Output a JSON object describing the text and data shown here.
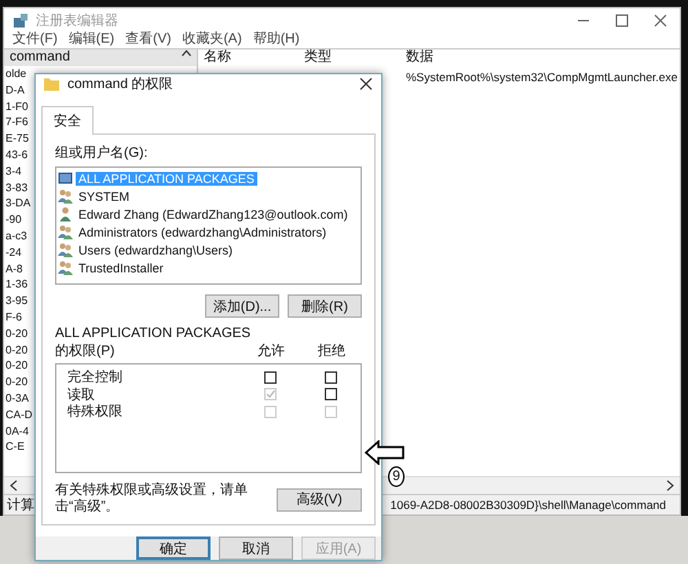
{
  "registry_editor": {
    "title": "注册表编辑器",
    "menu": [
      "文件(F)",
      "编辑(E)",
      "查看(V)",
      "收藏夹(A)",
      "帮助(H)"
    ],
    "tree": {
      "header": "command",
      "items": [
        "olde",
        "D-A",
        "1-F0",
        "7-F6",
        "E-75",
        "43-6",
        "3-4",
        "3-83",
        "3-DA",
        "-90",
        "a-c3",
        "-24",
        "A-8",
        "1-36",
        "3-95",
        "F-6",
        "0-20",
        "0-20",
        "0-20",
        "0-20",
        "0-3A",
        "CA-D",
        "0A-4",
        "C-E"
      ]
    },
    "values": {
      "columns": [
        "名称",
        "类型",
        "数据"
      ],
      "data": "%SystemRoot%\\system32\\CompMgmtLauncher.exe"
    },
    "status_bar": [
      "计算",
      "1069-A2D8-08002B30309D}\\shell\\Manage\\command"
    ]
  },
  "dialog": {
    "title": "command 的权限",
    "tabs": [
      {
        "label": "安全",
        "selected": true
      }
    ],
    "group_label": "组或用户名(G):",
    "principals": [
      {
        "name": "ALL APPLICATION PACKAGES",
        "kind": "package",
        "selected": true
      },
      {
        "name": "SYSTEM",
        "kind": "group",
        "selected": false
      },
      {
        "name": "Edward Zhang (EdwardZhang123@outlook.com)",
        "kind": "user",
        "selected": false
      },
      {
        "name": "Administrators (edwardzhang\\Administrators)",
        "kind": "group",
        "selected": false
      },
      {
        "name": "Users (edwardzhang\\Users)",
        "kind": "group",
        "selected": false
      },
      {
        "name": "TrustedInstaller",
        "kind": "group",
        "selected": false
      }
    ],
    "buttons": [
      "添加(D)...",
      "删除(R)"
    ],
    "permissions_for": "ALL APPLICATION PACKAGES",
    "permissions_label": "的权限(P)",
    "columns": [
      "允许",
      "拒绝"
    ],
    "permissions": [
      {
        "name": "完全控制",
        "allow": {
          "checked": false,
          "disabled": false
        },
        "deny": {
          "checked": false,
          "disabled": false
        }
      },
      {
        "name": "读取",
        "allow": {
          "checked": true,
          "disabled": true
        },
        "deny": {
          "checked": false,
          "disabled": false
        }
      },
      {
        "name": "特殊权限",
        "allow": {
          "checked": false,
          "disabled": true
        },
        "deny": {
          "checked": false,
          "disabled": true
        }
      }
    ],
    "advanced_note": "有关特殊权限或高级设置，请单击“高级”。",
    "advanced_button": "高级(V)",
    "footer_buttons": [
      {
        "label": "确定",
        "default": true,
        "disabled": false
      },
      {
        "label": "取消",
        "default": false,
        "disabled": false
      },
      {
        "label": "应用(A)",
        "default": false,
        "disabled": true
      }
    ]
  },
  "annotation": {
    "step": "9"
  }
}
